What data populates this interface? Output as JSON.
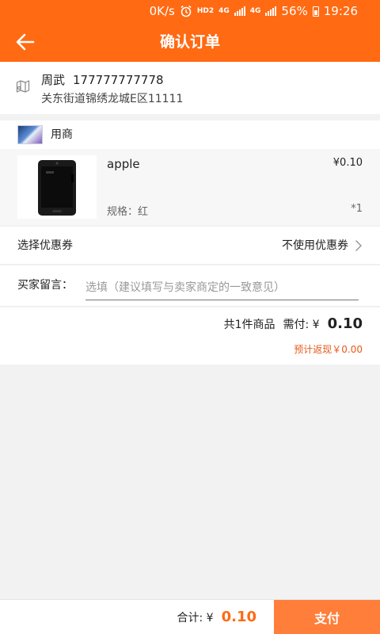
{
  "status_bar": {
    "speed": "0K/s",
    "network_label": "HD2",
    "signal_label_1": "4G",
    "signal_label_2": "4G",
    "battery": "56%",
    "time": "19:26"
  },
  "header": {
    "title": "确认订单"
  },
  "address": {
    "name": "周武",
    "phone": "177777777778",
    "detail": "关东街道锦绣龙城E区11111"
  },
  "shop": {
    "name": "用商"
  },
  "product": {
    "name": "apple",
    "price": "¥0.10",
    "spec": "规格：红",
    "quantity": "*1"
  },
  "coupon": {
    "label": "选择优惠券",
    "value": "不使用优惠券"
  },
  "message": {
    "label": "买家留言：",
    "placeholder": "选填（建议填写与卖家商定的一致意见）"
  },
  "summary": {
    "count_text": "共1件商品",
    "pay_label": "需付: ¥",
    "amount": "0.10",
    "rebate": "预计返现￥0.00"
  },
  "footer": {
    "total_label": "合计: ¥",
    "total_amount": "0.10",
    "pay_button": "支付"
  },
  "colors": {
    "accent": "#ff6a13",
    "pay_button": "#ff7e3a",
    "rebate": "#e85a1a"
  }
}
